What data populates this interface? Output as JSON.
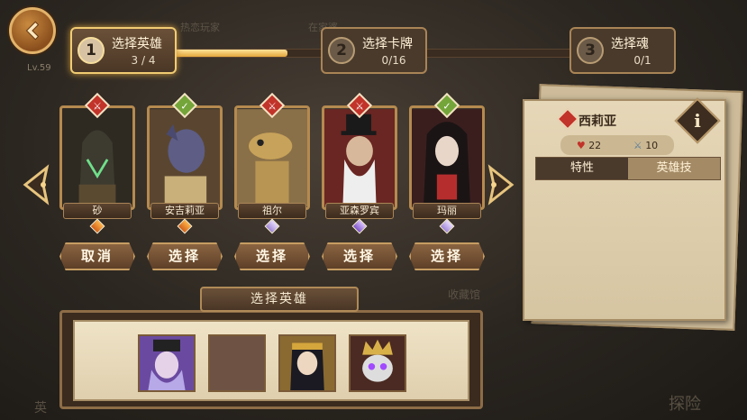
{
  "background": {
    "texts": [
      "热恋玩家",
      "在家婆",
      "收藏馆",
      "探险",
      "英"
    ]
  },
  "player_level": "Lv.59",
  "steps": [
    {
      "num": "1",
      "label": "选择英雄",
      "count": "3 / 4",
      "active": true
    },
    {
      "num": "2",
      "label": "选择卡牌",
      "count": "0/16",
      "active": false
    },
    {
      "num": "3",
      "label": "选择魂",
      "count": "0/1",
      "active": false
    }
  ],
  "progress": 0.28,
  "heroes": [
    {
      "name": "砂",
      "badge": "sword",
      "gem": "orange",
      "button": "取消"
    },
    {
      "name": "安吉莉亚",
      "badge": "check",
      "gem": "orange",
      "button": "选择"
    },
    {
      "name": "祖尔",
      "badge": "sword",
      "gem": "lavender",
      "button": "选择"
    },
    {
      "name": "亚森罗宾",
      "badge": "sword",
      "gem": "purple",
      "button": "选择"
    },
    {
      "name": "玛丽",
      "badge": "check",
      "gem": "lavender",
      "button": "选择"
    }
  ],
  "detail": {
    "name": "西莉亚",
    "info_label": "i",
    "hp": "22",
    "attack": "10",
    "tabs": [
      "特性",
      "英雄技"
    ]
  },
  "selection": {
    "title": "选择英雄",
    "slots": [
      "witch",
      "empty",
      "pharaoh",
      "skull"
    ]
  },
  "colors": {
    "accent": "#e3a63b",
    "frame": "#b58a4f",
    "panel": "#e6d7b8"
  }
}
